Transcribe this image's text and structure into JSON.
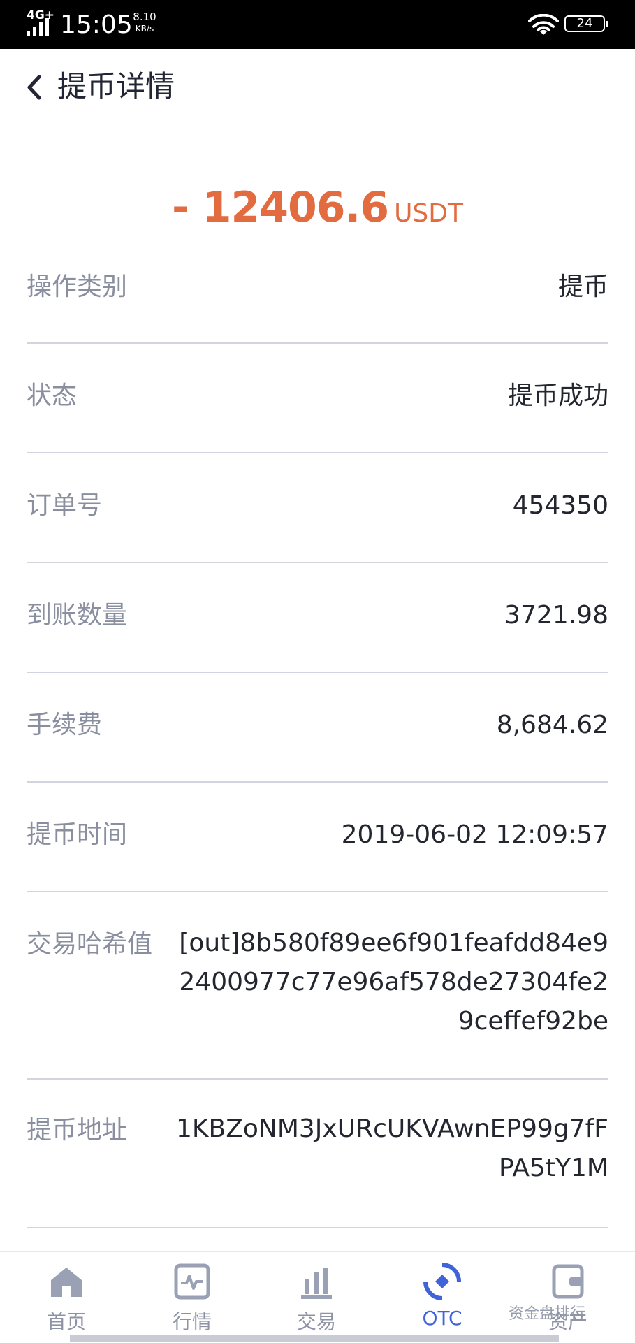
{
  "status_bar": {
    "network": "4G+",
    "time": "15:05",
    "speed_value": "8.10",
    "speed_unit": "KB/s",
    "battery": "24"
  },
  "header": {
    "title": "提币详情",
    "back_icon": "chevron-left-icon"
  },
  "amount": {
    "value": "- 12406.6",
    "unit": "USDT",
    "color": "#e26b40"
  },
  "details": {
    "type": {
      "label": "操作类别",
      "value": "提币"
    },
    "status": {
      "label": "状态",
      "value": "提币成功"
    },
    "order": {
      "label": "订单号",
      "value": "454350"
    },
    "received": {
      "label": "到账数量",
      "value": "3721.98"
    },
    "fee": {
      "label": "手续费",
      "value": "8,684.62"
    },
    "time": {
      "label": "提币时间",
      "value": "2019-06-02 12:09:57"
    },
    "hash": {
      "label": "交易哈希值",
      "value": "[out]8b580f89ee6f901feafdd84e92400977c77e96af578de27304fe29ceffef92be"
    },
    "address": {
      "label": "提币地址",
      "value": "1KBZoNM3JxURcUKVAwnEP99g7fFPA5tY1M"
    }
  },
  "tabs": [
    {
      "label": "首页",
      "icon": "home-icon"
    },
    {
      "label": "行情",
      "icon": "market-pulse-icon"
    },
    {
      "label": "交易",
      "icon": "bar-chart-icon"
    },
    {
      "label": "OTC",
      "icon": "otc-icon",
      "active": true
    },
    {
      "label": "资产",
      "icon": "wallet-icon"
    }
  ],
  "watermark": "资金盘排行",
  "colors": {
    "accent": "#e26b40",
    "active_tab": "#3f63d8",
    "inactive_tab": "#8d93a5",
    "label": "#8a8f9f",
    "divider": "#d2d5df"
  }
}
